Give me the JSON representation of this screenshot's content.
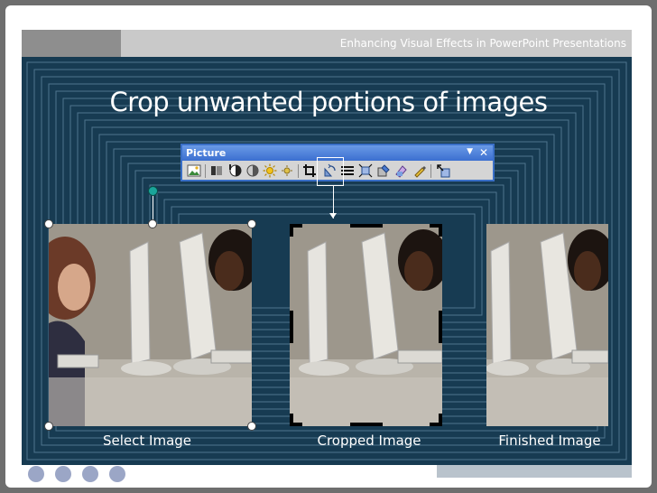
{
  "header": {
    "deck_title": "Enhancing Visual Effects in PowerPoint Presentations"
  },
  "slide": {
    "title": "Crop unwanted portions of images"
  },
  "toolbar": {
    "title": "Picture",
    "dropdown_icon": "triangle-down",
    "close_icon": "x",
    "buttons": [
      "insert-picture",
      "color",
      "more-contrast",
      "less-contrast",
      "more-brightness",
      "less-brightness",
      "crop",
      "rotate-left",
      "line-style",
      "compress-pictures",
      "recolor-picture",
      "format-picture",
      "set-transparent-color",
      "reset-picture"
    ]
  },
  "captions": {
    "select": "Select Image",
    "cropped": "Cropped Image",
    "finished": "Finished Image"
  },
  "colors": {
    "panel_bg": "#173b52",
    "title_bar": "#3b6fd0",
    "rotation_handle": "#1aa59a"
  }
}
